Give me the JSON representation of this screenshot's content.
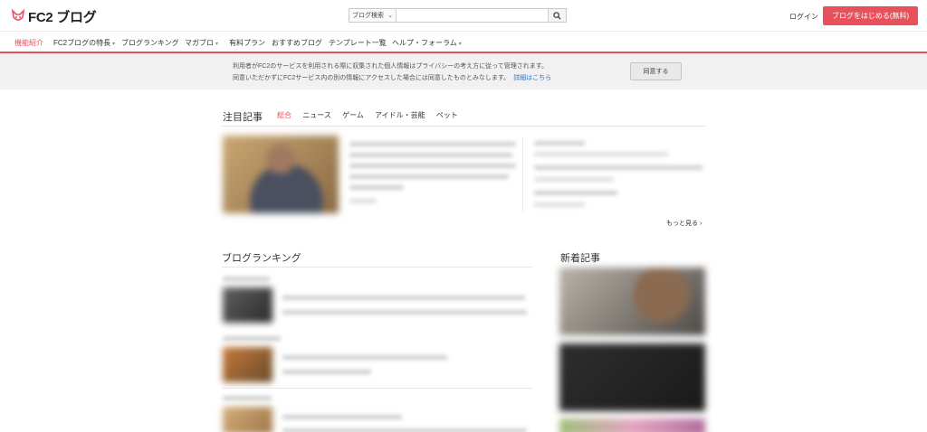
{
  "header": {
    "logo_text": "FC2 ブログ",
    "search": {
      "select_label": "ブログ検索",
      "placeholder": ""
    },
    "login_label": "ログイン",
    "start_button_label": "ブログをはじめる(無料)"
  },
  "nav": {
    "items": [
      {
        "label": "機能紹介",
        "active": true
      },
      {
        "label": "FC2ブログの特長",
        "dropdown": true
      },
      {
        "label": "ブログランキング"
      },
      {
        "label": "マガブロ",
        "dropdown": true
      },
      {
        "label": "有料プラン"
      },
      {
        "label": "おすすめブログ"
      },
      {
        "label": "テンプレート一覧"
      },
      {
        "label": "ヘルプ・フォーラム",
        "dropdown": true
      }
    ]
  },
  "consent": {
    "line1": "利用者がFC2のサービスを利用される際に収集された個人情報はプライバシーの考え方に従って管理されます。",
    "line2": "同意いただかずにFC2サービス内の別の情報にアクセスした場合には同意したものとみなします。",
    "details_link": "詳細はこちら",
    "agree_button": "同意する"
  },
  "featured": {
    "title": "注目記事",
    "tabs": [
      "総合",
      "ニュース",
      "ゲーム",
      "アイドル・芸能",
      "ペット"
    ],
    "more_link": "もっと見る ›"
  },
  "ranking": {
    "title": "ブログランキング"
  },
  "new_articles": {
    "title": "新着記事"
  },
  "colors": {
    "accent": "#e8505b",
    "link": "#2f6fc0"
  }
}
